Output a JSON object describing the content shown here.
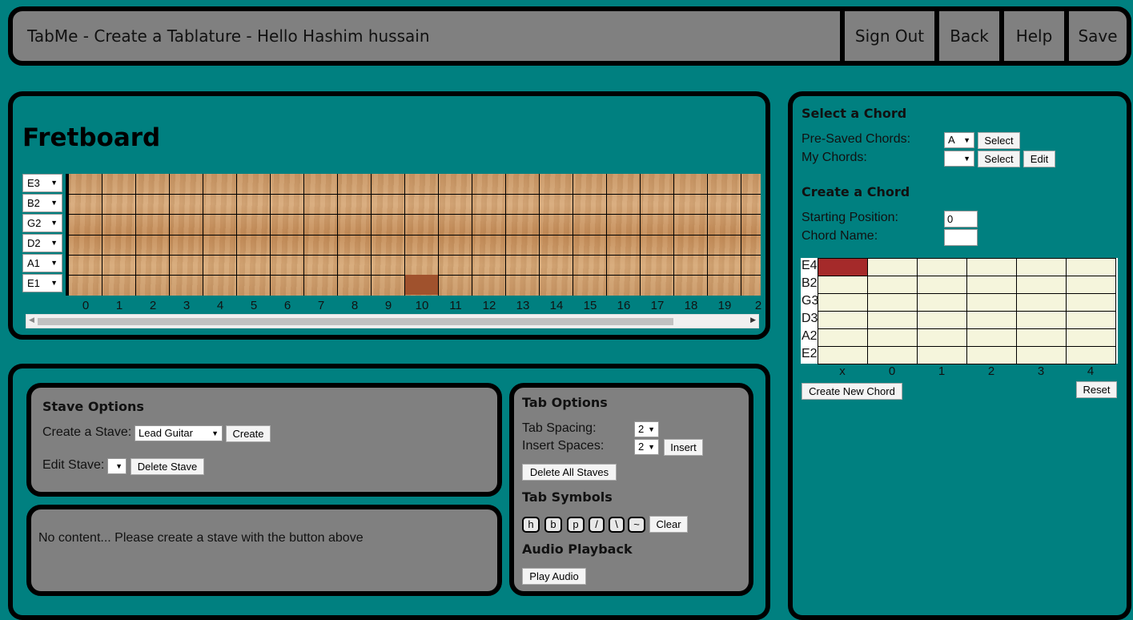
{
  "header": {
    "title": "TabMe - Create a Tablature - Hello Hashim hussain",
    "nav": [
      "Sign Out",
      "Back",
      "Help",
      "Save"
    ]
  },
  "fretboard": {
    "heading": "Fretboard",
    "strings": [
      "E3",
      "B2",
      "G2",
      "D2",
      "A1",
      "E1"
    ],
    "fret_numbers": [
      "0",
      "1",
      "2",
      "3",
      "4",
      "5",
      "6",
      "7",
      "8",
      "9",
      "10",
      "11",
      "12",
      "13",
      "14",
      "15",
      "16",
      "17",
      "18",
      "19",
      "2"
    ],
    "selected": {
      "string_index": 5,
      "fret": 10,
      "color": "#a0522d"
    }
  },
  "stave_options": {
    "heading": "Stave Options",
    "create_label": "Create a Stave:",
    "create_select": "Lead Guitar",
    "create_button": "Create",
    "edit_label": "Edit Stave:",
    "edit_select": "",
    "delete_button": "Delete Stave"
  },
  "stave_content": {
    "message": "No content... Please create a stave with the button above"
  },
  "tab_options": {
    "heading": "Tab Options",
    "spacing_label": "Tab Spacing:",
    "spacing_value": "2",
    "insert_label": "Insert Spaces:",
    "insert_value": "2",
    "insert_button": "Insert",
    "delete_all_button": "Delete All Staves",
    "symbols_heading": "Tab Symbols",
    "symbols": [
      "h",
      "b",
      "p",
      "/",
      "\\",
      "~"
    ],
    "clear_button": "Clear",
    "audio_heading": "Audio Playback",
    "play_button": "Play Audio"
  },
  "chord": {
    "select_heading": "Select a Chord",
    "presaved_label": "Pre-Saved Chords:",
    "presaved_value": "A",
    "select_button": "Select",
    "my_label": "My Chords:",
    "my_value": "",
    "select_button2": "Select",
    "edit_button": "Edit",
    "create_heading": "Create a Chord",
    "start_label": "Starting Position:",
    "start_value": "0",
    "name_label": "Chord Name:",
    "name_value": "",
    "strings": [
      "E4",
      "B2",
      "G3",
      "D3",
      "A2",
      "E2"
    ],
    "columns": [
      "x",
      "0",
      "1",
      "2",
      "3",
      "4"
    ],
    "selected": {
      "string_index": 0,
      "column": 0,
      "color": "#a52a2a"
    },
    "create_button": "Create New Chord",
    "reset_button": "Reset"
  },
  "colors": {
    "background": "#008080",
    "panel": "#808080",
    "chord_cell": "#f5f5dc"
  }
}
